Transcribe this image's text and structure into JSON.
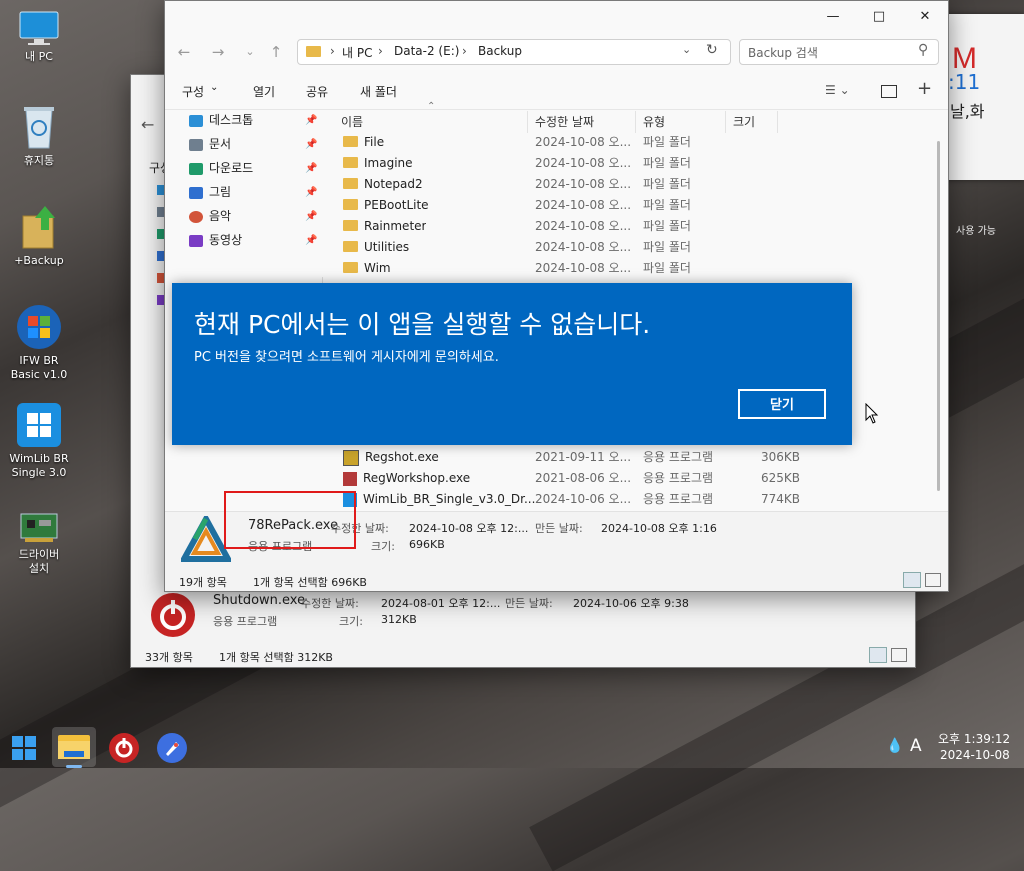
{
  "desktop": {
    "icons": [
      {
        "label": "내 PC",
        "icon": "monitor-icon"
      },
      {
        "label": "휴지통",
        "icon": "recycle-bin-icon"
      },
      {
        "label": "+Backup",
        "icon": "backup-folder-icon"
      },
      {
        "label": "IFW BR Basic v1.0",
        "icon": "windows-logo-icon"
      },
      {
        "label": "WimLib BR Single 3.0",
        "icon": "windows-tile-icon"
      },
      {
        "label": "드라이버 설치",
        "icon": "circuit-board-icon"
      }
    ]
  },
  "widget": {
    "partial_letter": "M",
    "partial_time": ":11",
    "partial_day": "날,화",
    "partial_note": "사용 가능"
  },
  "back_window": {
    "toolbar_partial": "구성",
    "details": {
      "file_name": "Shutdown.exe",
      "file_type": "응용 프로그램",
      "modified_label": "수정한 날짜:",
      "modified_value": "2024-08-01 오후 12:...",
      "created_label": "만든 날짜:",
      "created_value": "2024-10-06 오후 9:38",
      "size_label": "크기:",
      "size_value": "312KB"
    },
    "status": {
      "count": "33개 항목",
      "selected": "1개 항목 선택함 312KB"
    }
  },
  "front_window": {
    "breadcrumb": [
      "내 PC",
      "Data-2 (E:)",
      "Backup"
    ],
    "search_placeholder": "Backup 검색",
    "toolbar": {
      "organize": "구성",
      "open": "열기",
      "share": "공유",
      "new_folder": "새 폴더"
    },
    "nav": [
      {
        "label": "데스크톱",
        "icon": "desktop-icon",
        "color": "#2b8fd6"
      },
      {
        "label": "문서",
        "icon": "document-icon",
        "color": "#6f7f8f"
      },
      {
        "label": "다운로드",
        "icon": "download-icon",
        "color": "#1f9a6a"
      },
      {
        "label": "그림",
        "icon": "pictures-icon",
        "color": "#2f6fcf"
      },
      {
        "label": "음악",
        "icon": "music-icon",
        "color": "#d2543a"
      },
      {
        "label": "동영상",
        "icon": "video-icon",
        "color": "#7a3cc4"
      }
    ],
    "columns": {
      "name": "이름",
      "modified": "수정한 날짜",
      "type": "유형",
      "size": "크기"
    },
    "rows_top": [
      {
        "name": "File",
        "modified": "2024-10-08 오...",
        "type": "파일 폴더",
        "size": ""
      },
      {
        "name": "Imagine",
        "modified": "2024-10-08 오...",
        "type": "파일 폴더",
        "size": ""
      },
      {
        "name": "Notepad2",
        "modified": "2024-10-08 오...",
        "type": "파일 폴더",
        "size": ""
      },
      {
        "name": "PEBootLite",
        "modified": "2024-10-08 오...",
        "type": "파일 폴더",
        "size": ""
      },
      {
        "name": "Rainmeter",
        "modified": "2024-10-08 오...",
        "type": "파일 폴더",
        "size": ""
      },
      {
        "name": "Utilities",
        "modified": "2024-10-08 오...",
        "type": "파일 폴더",
        "size": ""
      },
      {
        "name": "Wim",
        "modified": "2024-10-08 오...",
        "type": "파일 폴더",
        "size": ""
      }
    ],
    "rows_bottom": [
      {
        "name": "Regshot.exe",
        "modified": "2021-09-11 오...",
        "type": "응용 프로그램",
        "size": "306KB"
      },
      {
        "name": "RegWorkshop.exe",
        "modified": "2021-08-06 오...",
        "type": "응용 프로그램",
        "size": "625KB"
      },
      {
        "name": "WimLib_BR_Single_v3.0_Dr...",
        "modified": "2024-10-06 오...",
        "type": "응용 프로그램",
        "size": "774KB"
      }
    ],
    "details": {
      "file_name": "78RePack.exe",
      "file_type": "응용 프로그램",
      "modified_label": "수정한 날짜:",
      "modified_value": "2024-10-08 오후 12:...",
      "created_label": "만든 날짜:",
      "created_value": "2024-10-08 오후 1:16",
      "size_label": "크기:",
      "size_value": "696KB"
    },
    "status": {
      "count": "19개 항목",
      "selected": "1개 항목 선택함 696KB"
    }
  },
  "dialog": {
    "title": "현재 PC에서는 이 앱을 실행할 수 없습니다.",
    "message": "PC 버전을 찾으려면 소프트웨어 게시자에게 문의하세요.",
    "close_label": "닫기",
    "bg_color": "#0067c0"
  },
  "taskbar": {
    "time": "오후 1:39:12",
    "date": "2024-10-08",
    "ime": "A"
  }
}
